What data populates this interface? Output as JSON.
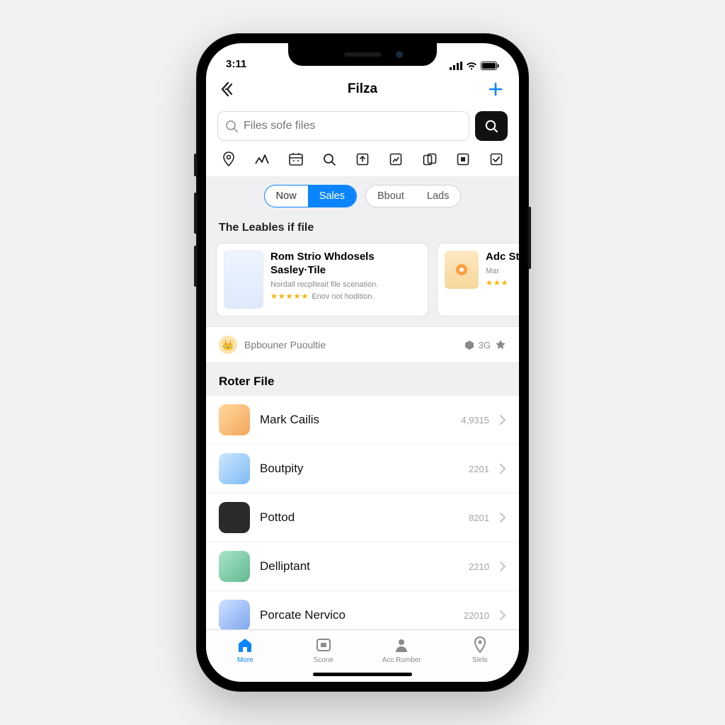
{
  "status": {
    "time": "3:11"
  },
  "nav": {
    "title": "Filza"
  },
  "search": {
    "placeholder": "Files sofe files"
  },
  "segments": {
    "a": [
      "Now",
      "Sales"
    ],
    "b": [
      "Bbout",
      "Lads"
    ]
  },
  "section1": {
    "header": "The Leables if file",
    "cards": [
      {
        "title": "Rom Strio Whdosels Sasley·Tile",
        "sub1": "Nordall recplleait file scenation.",
        "stars_label": "Enov not hodition."
      },
      {
        "title": "Adc Sty",
        "sub1": "Mar"
      }
    ]
  },
  "banner": {
    "text": "Bpbouner Puoultie",
    "meta": "3G"
  },
  "section2": {
    "header": "Roter File",
    "rows": [
      {
        "label": "Mark Cailis",
        "meta": "4,9315"
      },
      {
        "label": "Boutpity",
        "meta": "2201"
      },
      {
        "label": "Pottod",
        "meta": "8201"
      },
      {
        "label": "Delliptant",
        "meta": "2210"
      },
      {
        "label": "Porcate Nervico",
        "meta": "22010"
      }
    ]
  },
  "tabs": [
    {
      "label": "More"
    },
    {
      "label": "Scone"
    },
    {
      "label": "Acc Rumber"
    },
    {
      "label": "Slels"
    }
  ]
}
